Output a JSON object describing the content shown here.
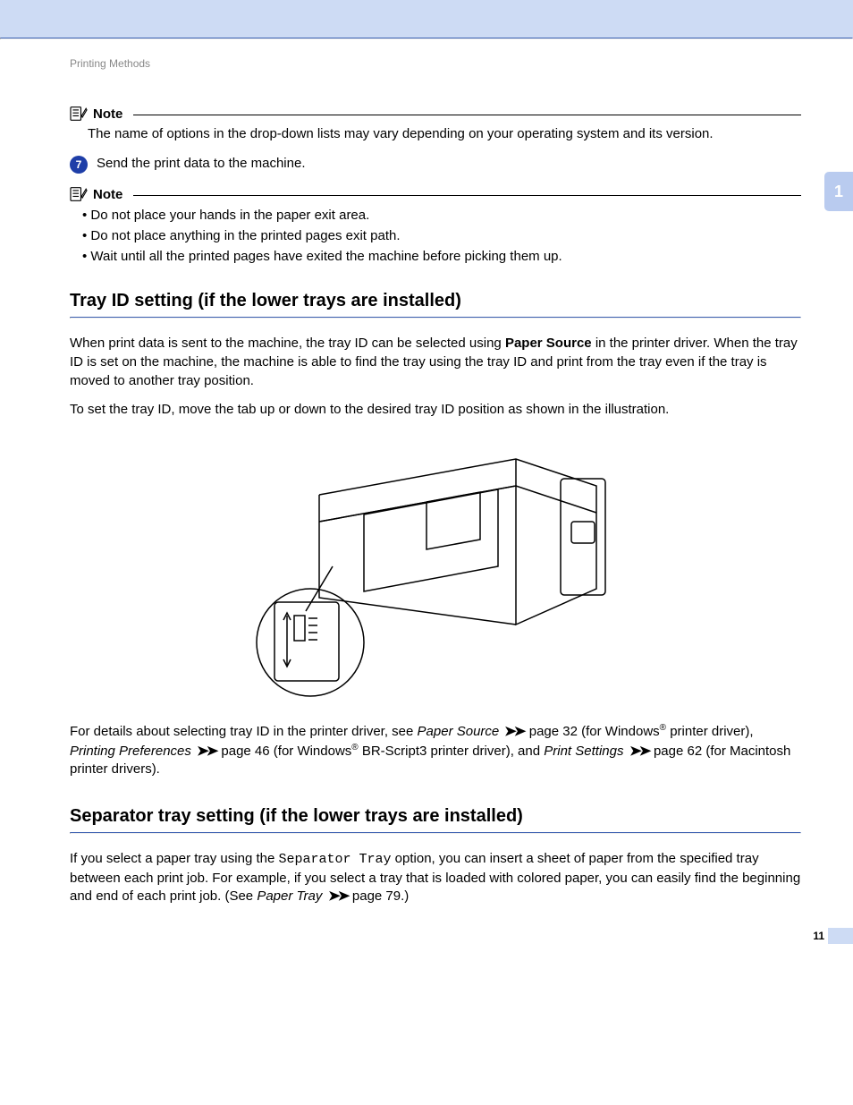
{
  "breadcrumb": "Printing Methods",
  "chapter_tab": "1",
  "note1": {
    "heading": "Note",
    "body": "The name of options in the drop-down lists may vary depending on your operating system and its version."
  },
  "step7": {
    "number": "7",
    "text": "Send the print data to the machine."
  },
  "note2": {
    "heading": "Note",
    "bullets": [
      "Do not place your hands in the paper exit area.",
      "Do not place anything in the printed pages exit path.",
      "Wait until all the printed pages have exited the machine before picking them up."
    ]
  },
  "section_tray": {
    "title": "Tray ID setting (if the lower trays are installed)",
    "p1_a": "When print data is sent to the machine, the tray ID can be selected using ",
    "p1_bold": "Paper Source",
    "p1_b": " in the printer driver. When the tray ID is set on the machine, the machine is able to find the tray using the tray ID and print from the tray even if the tray is moved to another tray position.",
    "p2": "To set the tray ID, move the tab up or down to the desired tray ID position as shown in the illustration.",
    "details_a": "For details about selecting tray ID in the printer driver, see ",
    "details_ps": "Paper Source",
    "details_ps_page": " page 32 (for Windows",
    "reg": "®",
    "details_ps_after": " printer driver), ",
    "details_pp": "Printing Preferences",
    "details_pp_page": " page 46 (for Windows",
    "details_pp_after": " BR-Script3 printer driver), and ",
    "details_pset": "Print Settings",
    "details_pset_page": " page 62 (for Macintosh printer drivers)."
  },
  "section_sep": {
    "title": "Separator tray setting (if the lower trays are installed)",
    "p1_a": "If you select a paper tray using the ",
    "p1_mono": "Separator Tray",
    "p1_b": " option, you can insert a sheet of paper from the specified tray between each print job. For example, if you select a tray that is loaded with colored paper, you can easily find the beginning and end of each print job. (See ",
    "p1_ital": "Paper Tray",
    "p1_c": " page 79.)"
  },
  "page_number": "11"
}
